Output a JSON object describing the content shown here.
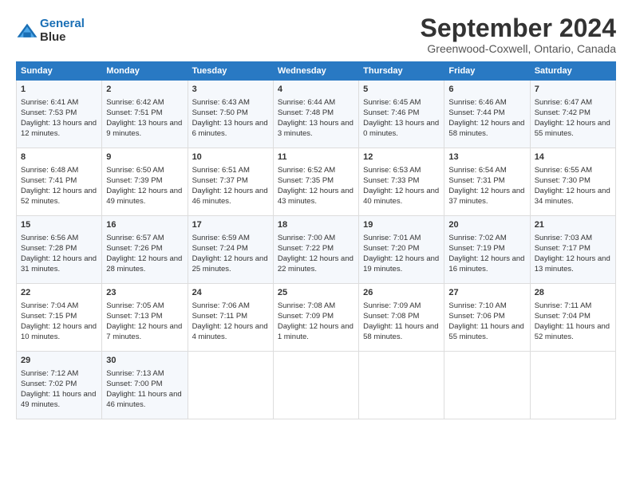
{
  "logo": {
    "line1": "General",
    "line2": "Blue"
  },
  "title": "September 2024",
  "subtitle": "Greenwood-Coxwell, Ontario, Canada",
  "headers": [
    "Sunday",
    "Monday",
    "Tuesday",
    "Wednesday",
    "Thursday",
    "Friday",
    "Saturday"
  ],
  "weeks": [
    [
      {
        "day": "1",
        "sunrise": "6:41 AM",
        "sunset": "7:53 PM",
        "daylight": "13 hours and 12 minutes."
      },
      {
        "day": "2",
        "sunrise": "6:42 AM",
        "sunset": "7:51 PM",
        "daylight": "13 hours and 9 minutes."
      },
      {
        "day": "3",
        "sunrise": "6:43 AM",
        "sunset": "7:50 PM",
        "daylight": "13 hours and 6 minutes."
      },
      {
        "day": "4",
        "sunrise": "6:44 AM",
        "sunset": "7:48 PM",
        "daylight": "13 hours and 3 minutes."
      },
      {
        "day": "5",
        "sunrise": "6:45 AM",
        "sunset": "7:46 PM",
        "daylight": "13 hours and 0 minutes."
      },
      {
        "day": "6",
        "sunrise": "6:46 AM",
        "sunset": "7:44 PM",
        "daylight": "12 hours and 58 minutes."
      },
      {
        "day": "7",
        "sunrise": "6:47 AM",
        "sunset": "7:42 PM",
        "daylight": "12 hours and 55 minutes."
      }
    ],
    [
      {
        "day": "8",
        "sunrise": "6:48 AM",
        "sunset": "7:41 PM",
        "daylight": "12 hours and 52 minutes."
      },
      {
        "day": "9",
        "sunrise": "6:50 AM",
        "sunset": "7:39 PM",
        "daylight": "12 hours and 49 minutes."
      },
      {
        "day": "10",
        "sunrise": "6:51 AM",
        "sunset": "7:37 PM",
        "daylight": "12 hours and 46 minutes."
      },
      {
        "day": "11",
        "sunrise": "6:52 AM",
        "sunset": "7:35 PM",
        "daylight": "12 hours and 43 minutes."
      },
      {
        "day": "12",
        "sunrise": "6:53 AM",
        "sunset": "7:33 PM",
        "daylight": "12 hours and 40 minutes."
      },
      {
        "day": "13",
        "sunrise": "6:54 AM",
        "sunset": "7:31 PM",
        "daylight": "12 hours and 37 minutes."
      },
      {
        "day": "14",
        "sunrise": "6:55 AM",
        "sunset": "7:30 PM",
        "daylight": "12 hours and 34 minutes."
      }
    ],
    [
      {
        "day": "15",
        "sunrise": "6:56 AM",
        "sunset": "7:28 PM",
        "daylight": "12 hours and 31 minutes."
      },
      {
        "day": "16",
        "sunrise": "6:57 AM",
        "sunset": "7:26 PM",
        "daylight": "12 hours and 28 minutes."
      },
      {
        "day": "17",
        "sunrise": "6:59 AM",
        "sunset": "7:24 PM",
        "daylight": "12 hours and 25 minutes."
      },
      {
        "day": "18",
        "sunrise": "7:00 AM",
        "sunset": "7:22 PM",
        "daylight": "12 hours and 22 minutes."
      },
      {
        "day": "19",
        "sunrise": "7:01 AM",
        "sunset": "7:20 PM",
        "daylight": "12 hours and 19 minutes."
      },
      {
        "day": "20",
        "sunrise": "7:02 AM",
        "sunset": "7:19 PM",
        "daylight": "12 hours and 16 minutes."
      },
      {
        "day": "21",
        "sunrise": "7:03 AM",
        "sunset": "7:17 PM",
        "daylight": "12 hours and 13 minutes."
      }
    ],
    [
      {
        "day": "22",
        "sunrise": "7:04 AM",
        "sunset": "7:15 PM",
        "daylight": "12 hours and 10 minutes."
      },
      {
        "day": "23",
        "sunrise": "7:05 AM",
        "sunset": "7:13 PM",
        "daylight": "12 hours and 7 minutes."
      },
      {
        "day": "24",
        "sunrise": "7:06 AM",
        "sunset": "7:11 PM",
        "daylight": "12 hours and 4 minutes."
      },
      {
        "day": "25",
        "sunrise": "7:08 AM",
        "sunset": "7:09 PM",
        "daylight": "12 hours and 1 minute."
      },
      {
        "day": "26",
        "sunrise": "7:09 AM",
        "sunset": "7:08 PM",
        "daylight": "11 hours and 58 minutes."
      },
      {
        "day": "27",
        "sunrise": "7:10 AM",
        "sunset": "7:06 PM",
        "daylight": "11 hours and 55 minutes."
      },
      {
        "day": "28",
        "sunrise": "7:11 AM",
        "sunset": "7:04 PM",
        "daylight": "11 hours and 52 minutes."
      }
    ],
    [
      {
        "day": "29",
        "sunrise": "7:12 AM",
        "sunset": "7:02 PM",
        "daylight": "11 hours and 49 minutes."
      },
      {
        "day": "30",
        "sunrise": "7:13 AM",
        "sunset": "7:00 PM",
        "daylight": "11 hours and 46 minutes."
      },
      null,
      null,
      null,
      null,
      null
    ]
  ]
}
